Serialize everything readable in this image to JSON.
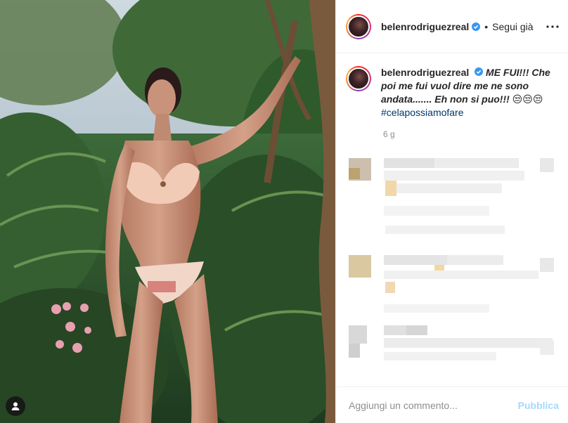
{
  "post": {
    "username": "belenrodriguezreal",
    "follow_label": "Segui già",
    "separator": "•",
    "caption_user": "belenrodriguezreal",
    "caption_lead": "ME FUI!!! ",
    "caption_body": "Che poi me fui vuol dire me ne sono andata....... ",
    "caption_tail": "Eh non si puo!!! ",
    "caption_emoji": "😒😒😒",
    "hashtag": "#celapossiamofare",
    "time_ago": "6 g"
  },
  "comment_box": {
    "placeholder": "Aggiungi un commento...",
    "publish_label": "Pubblica"
  },
  "icons": {
    "verified": "verified-badge-icon",
    "more": "more-options-icon",
    "tag": "user-tag-icon"
  },
  "colors": {
    "accent": "#0095f6",
    "verified": "#3897f0",
    "secondary_text": "#8e8e8e",
    "hashtag": "#00376b"
  }
}
